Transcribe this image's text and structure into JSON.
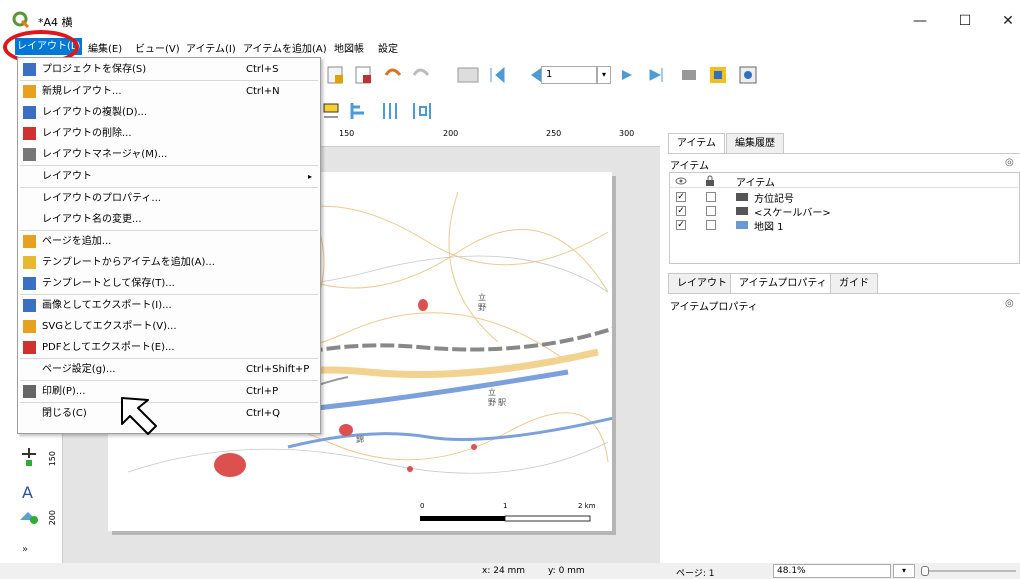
{
  "window": {
    "title": "*A4  横",
    "controls": [
      "—",
      "☐",
      "✕"
    ]
  },
  "menubar": {
    "items": [
      "レイアウト(L)",
      "編集(E)",
      "ビュー(V)",
      "アイテム(I)",
      "アイテムを追加(A)",
      "地図帳",
      "設定"
    ]
  },
  "page_input": {
    "value": "1"
  },
  "layout_menu": {
    "items": [
      {
        "label": "プロジェクトを保存(S)",
        "shortcut": "Ctrl+S",
        "icon": "save-icon"
      },
      {
        "label": "新規レイアウト...",
        "shortcut": "Ctrl+N",
        "icon": "new-layout-icon"
      },
      {
        "label": "レイアウトの複製(D)...",
        "shortcut": "",
        "icon": "duplicate-icon"
      },
      {
        "label": "レイアウトの削除...",
        "shortcut": "",
        "icon": "delete-icon"
      },
      {
        "label": "レイアウトマネージャ(M)...",
        "shortcut": "",
        "icon": "manager-icon"
      },
      {
        "label": "レイアウト",
        "shortcut": "",
        "icon": "",
        "submenu": true
      },
      {
        "label": "レイアウトのプロパティ...",
        "shortcut": "",
        "icon": ""
      },
      {
        "label": "レイアウト名の変更...",
        "shortcut": "",
        "icon": ""
      },
      {
        "label": "ページを追加...",
        "shortcut": "",
        "icon": "add-page-icon"
      },
      {
        "label": "テンプレートからアイテムを追加(A)...",
        "shortcut": "",
        "icon": "folder-icon"
      },
      {
        "label": "テンプレートとして保存(T)...",
        "shortcut": "",
        "icon": "save-template-icon"
      },
      {
        "label": "画像としてエクスポート(I)...",
        "shortcut": "",
        "icon": "export-image-icon"
      },
      {
        "label": "SVGとしてエクスポート(V)...",
        "shortcut": "",
        "icon": "export-svg-icon"
      },
      {
        "label": "PDFとしてエクスポート(E)...",
        "shortcut": "",
        "icon": "export-pdf-icon"
      },
      {
        "label": "ページ設定(g)...",
        "shortcut": "Ctrl+Shift+P",
        "icon": ""
      },
      {
        "label": "印刷(P)...",
        "shortcut": "Ctrl+P",
        "icon": "print-icon"
      },
      {
        "label": "閉じる(C)",
        "shortcut": "Ctrl+Q",
        "icon": ""
      }
    ]
  },
  "ruler": {
    "ticks": [
      "150",
      "200",
      "250",
      "300"
    ],
    "vticks": [
      "150",
      "200"
    ]
  },
  "panel": {
    "top_tabs": [
      "アイテム",
      "編集履歴"
    ],
    "items_heading": "アイテム",
    "items_column": "アイテム",
    "items": [
      {
        "name": "方位記号",
        "checked": true
      },
      {
        "name": "<スケールバー>",
        "checked": true
      },
      {
        "name": "地図 1",
        "checked": true
      }
    ],
    "bottom_tabs": [
      "レイアウト",
      "アイテムプロパティ",
      "ガイド"
    ],
    "props_heading": "アイテムプロパティ"
  },
  "map": {
    "labels": [
      "立",
      "野",
      "立",
      "野",
      "駅",
      "錦"
    ],
    "scale_labels": [
      "0",
      "1",
      "2 km"
    ]
  },
  "status": {
    "x": "x: 24 mm",
    "y": "y: 0 mm",
    "page": "ページ: 1",
    "zoom": "48.1%"
  }
}
